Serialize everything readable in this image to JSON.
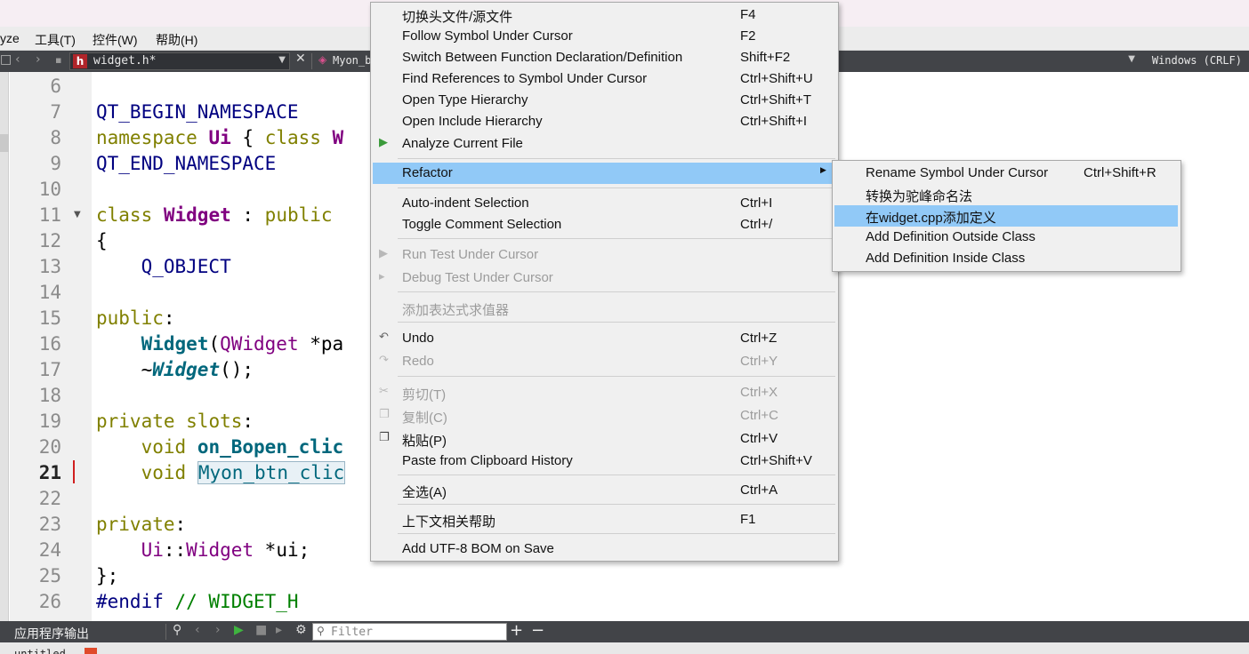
{
  "menubar": {
    "items": [
      "yze",
      "工具(T)",
      "控件(W)",
      "帮助(H)"
    ]
  },
  "editor_toolbar": {
    "file_name": "widget.h*",
    "symbol": "Myon_btn_clicked()",
    "line_ending": "Windows (CRLF)"
  },
  "editor": {
    "current_line": 21,
    "lines": [
      {
        "num": "6"
      },
      {
        "num": "7"
      },
      {
        "num": "8"
      },
      {
        "num": "9"
      },
      {
        "num": "10"
      },
      {
        "num": "11"
      },
      {
        "num": "12"
      },
      {
        "num": "13"
      },
      {
        "num": "14"
      },
      {
        "num": "15"
      },
      {
        "num": "16"
      },
      {
        "num": "17"
      },
      {
        "num": "18"
      },
      {
        "num": "19"
      },
      {
        "num": "20"
      },
      {
        "num": "21"
      },
      {
        "num": "22"
      },
      {
        "num": "23"
      },
      {
        "num": "24"
      },
      {
        "num": "25"
      },
      {
        "num": "26"
      }
    ],
    "code": {
      "l7": "QT_BEGIN_NAMESPACE",
      "l8_kw": "namespace",
      "l8_ui": "Ui",
      "l8_rest": " { ",
      "l8_class": "class",
      "l8_w": " W",
      "l9": "QT_END_NAMESPACE",
      "l11_class": "class",
      "l11_name": "Widget",
      "l11_colon": " : ",
      "l11_public": "public",
      "l12": "{",
      "l13": "Q_OBJECT",
      "l15_public": "public",
      "l15_colon": ":",
      "l16_fn": "Widget",
      "l16_paren": "(",
      "l16_type": "QWidget",
      "l16_rest": " *pa",
      "l17_tilde": "~",
      "l17_fn": "Widget",
      "l17_rest": "();",
      "l19_private": "private",
      "l19_slots": " slots",
      "l19_colon": ":",
      "l20_void": "void",
      "l20_fn": "on_Bopen_clic",
      "l21_void": "void",
      "l21_fn": "Myon_btn_clic",
      "l23_private": "private",
      "l23_colon": ":",
      "l24_ns": "Ui",
      "l24_sep": "::",
      "l24_type": "Widget",
      "l24_rest": " *ui;",
      "l25": "};",
      "l26_dir": "#endif",
      "l26_comment": " // WIDGET_H"
    }
  },
  "context_menu": {
    "items": [
      {
        "label": "切换头文件/源文件",
        "shortcut": "F4"
      },
      {
        "label": "Follow Symbol Under Cursor",
        "shortcut": "F2"
      },
      {
        "label": "Switch Between Function Declaration/Definition",
        "shortcut": "Shift+F2"
      },
      {
        "label": "Find References to Symbol Under Cursor",
        "shortcut": "Ctrl+Shift+U"
      },
      {
        "label": "Open Type Hierarchy",
        "shortcut": "Ctrl+Shift+T"
      },
      {
        "label": "Open Include Hierarchy",
        "shortcut": "Ctrl+Shift+I"
      },
      {
        "label": "Analyze Current File",
        "shortcut": ""
      },
      {
        "label": "Refactor",
        "shortcut": ""
      },
      {
        "label": "Auto-indent Selection",
        "shortcut": "Ctrl+I"
      },
      {
        "label": "Toggle Comment Selection",
        "shortcut": "Ctrl+/"
      },
      {
        "label": "Run Test Under Cursor",
        "shortcut": ""
      },
      {
        "label": "Debug Test Under Cursor",
        "shortcut": ""
      },
      {
        "label": "添加表达式求值器",
        "shortcut": ""
      },
      {
        "label": "Undo",
        "shortcut": "Ctrl+Z"
      },
      {
        "label": "Redo",
        "shortcut": "Ctrl+Y"
      },
      {
        "label": "剪切(T)",
        "shortcut": "Ctrl+X"
      },
      {
        "label": "复制(C)",
        "shortcut": "Ctrl+C"
      },
      {
        "label": "粘贴(P)",
        "shortcut": "Ctrl+V"
      },
      {
        "label": "Paste from Clipboard History",
        "shortcut": "Ctrl+Shift+V"
      },
      {
        "label": "全选(A)",
        "shortcut": "Ctrl+A"
      },
      {
        "label": "上下文相关帮助",
        "shortcut": "F1"
      },
      {
        "label": "Add UTF-8 BOM on Save",
        "shortcut": ""
      }
    ]
  },
  "refactor_submenu": {
    "items": [
      {
        "label": "Rename Symbol Under Cursor",
        "shortcut": "Ctrl+Shift+R"
      },
      {
        "label": "转换为驼峰命名法",
        "shortcut": ""
      },
      {
        "label": "在widget.cpp添加定义",
        "shortcut": ""
      },
      {
        "label": "Add Definition Outside Class",
        "shortcut": ""
      },
      {
        "label": "Add Definition Inside Class",
        "shortcut": ""
      }
    ]
  },
  "output_pane": {
    "title": "应用程序输出",
    "filter_placeholder": "Filter",
    "tab_label": "untitled"
  }
}
